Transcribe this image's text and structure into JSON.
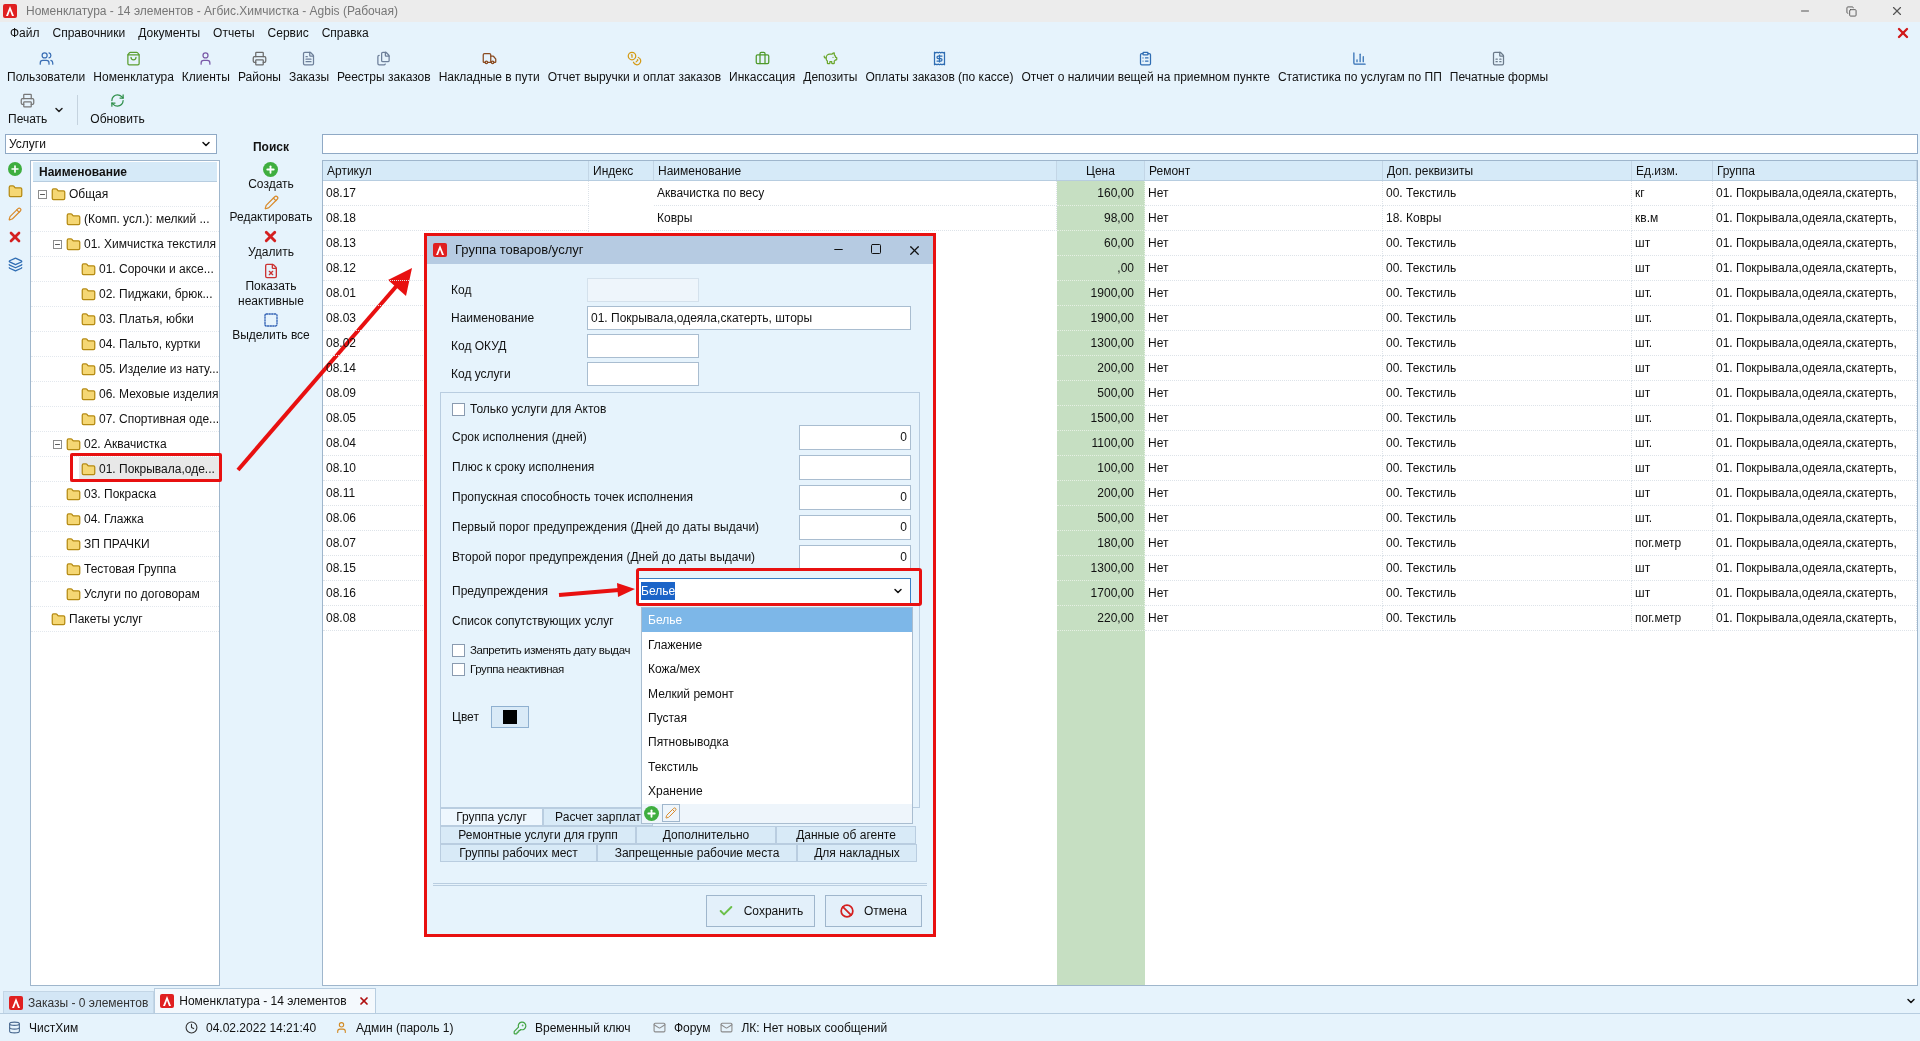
{
  "window": {
    "title": "Номенклатура - 14 элементов - Агбис.Химчистка - Agbis (Рабочая)"
  },
  "menu": [
    "Файл",
    "Справочники",
    "Документы",
    "Отчеты",
    "Сервис",
    "Справка"
  ],
  "toolbar": [
    "Пользователи",
    "Номенклатура",
    "Клиенты",
    "Районы",
    "Заказы",
    "Реестры заказов",
    "Накладные в пути",
    "Отчет выручки и оплат заказов",
    "Инкассация",
    "Депозиты",
    "Оплаты заказов (по кассе)",
    "Отчет о наличии вещей на приемном пункте",
    "Статистика по услугам по ПП",
    "Печатные формы"
  ],
  "toolbar2": [
    {
      "label": "Печать",
      "has_menu": true
    },
    {
      "label": "Обновить",
      "has_menu": false
    }
  ],
  "category_select": {
    "value": "Услуги"
  },
  "tree": {
    "column": "Наименование",
    "items": [
      {
        "label": "Общая",
        "expanded": true,
        "selected": false,
        "children": [
          {
            "label": "(Комп. усл.): мелкий ...",
            "selected": false
          },
          {
            "label": "01. Химчистка текстиля",
            "expanded": true,
            "selected": false,
            "children": [
              {
                "label": "01. Сорочки и аксе...",
                "selected": false
              },
              {
                "label": "02. Пиджаки, брюк...",
                "selected": false
              },
              {
                "label": "03. Платья, юбки",
                "selected": false
              },
              {
                "label": "04. Пальто, куртки",
                "selected": false
              },
              {
                "label": "05. Изделие из нату...",
                "selected": false
              },
              {
                "label": "06. Меховые изделия",
                "selected": false
              },
              {
                "label": "07. Спортивная оде...",
                "selected": false
              }
            ]
          },
          {
            "label": "02. Аквачистка",
            "expanded": true,
            "selected": false,
            "children": [
              {
                "label": "01. Покрывала,оде...",
                "selected": true
              }
            ]
          },
          {
            "label": "03. Покраска",
            "selected": false
          },
          {
            "label": "04. Глажка",
            "selected": false
          },
          {
            "label": "ЗП ПРАЧКИ",
            "selected": false
          },
          {
            "label": "Тестовая Группа",
            "selected": false
          },
          {
            "label": "Услуги по договорам",
            "selected": false
          }
        ]
      },
      {
        "label": "Пакеты услуг",
        "selected": false
      }
    ]
  },
  "search": {
    "title": "Поиск",
    "actions": [
      {
        "label": "Создать",
        "kind": "create"
      },
      {
        "label": "Редактировать",
        "kind": "edit"
      },
      {
        "label": "Удалить",
        "kind": "delete"
      },
      {
        "label": "Показать неактивные",
        "kind": "inactive"
      },
      {
        "label": "Выделить все",
        "kind": "select_all"
      }
    ]
  },
  "table": {
    "columns": [
      {
        "label": "Артикул",
        "highlighted": false
      },
      {
        "label": "Индекс",
        "highlighted": false
      },
      {
        "label": "Наименование",
        "highlighted": false
      },
      {
        "label": "Цена",
        "highlighted": true
      },
      {
        "label": "Ремонт",
        "highlighted": false
      },
      {
        "label": "Доп. реквизиты",
        "highlighted": false
      },
      {
        "label": "Ед.изм.",
        "highlighted": false
      },
      {
        "label": "Группа",
        "highlighted": false
      }
    ],
    "rows": [
      {
        "article": "08.17",
        "name": "Аквачистка по весу",
        "price": "160,00",
        "repair": "Нет",
        "extra": "00. Текстиль",
        "unit": "кг",
        "group": "01. Покрывала,одеяла,скатерть,"
      },
      {
        "article": "08.18",
        "name": "Ковры",
        "price": "98,00",
        "repair": "Нет",
        "extra": "18. Ковры",
        "unit": "кв.м",
        "group": "01. Покрывала,одеяла,скатерть,"
      },
      {
        "article": "08.13",
        "price": "60,00",
        "repair": "Нет",
        "extra": "00. Текстиль",
        "unit": "шт",
        "group": "01. Покрывала,одеяла,скатерть,"
      },
      {
        "article": "08.12",
        "price": ",00",
        "repair": "Нет",
        "extra": "00. Текстиль",
        "unit": "шт",
        "group": "01. Покрывала,одеяла,скатерть,"
      },
      {
        "article": "08.01",
        "price": "1900,00",
        "repair": "Нет",
        "extra": "00. Текстиль",
        "unit": "шт.",
        "group": "01. Покрывала,одеяла,скатерть,"
      },
      {
        "article": "08.03",
        "price": "1900,00",
        "repair": "Нет",
        "extra": "00. Текстиль",
        "unit": "шт.",
        "group": "01. Покрывала,одеяла,скатерть,"
      },
      {
        "article": "08.02",
        "price": "1300,00",
        "repair": "Нет",
        "extra": "00. Текстиль",
        "unit": "шт.",
        "group": "01. Покрывала,одеяла,скатерть,"
      },
      {
        "article": "08.14",
        "price": "200,00",
        "repair": "Нет",
        "extra": "00. Текстиль",
        "unit": "шт",
        "group": "01. Покрывала,одеяла,скатерть,"
      },
      {
        "article": "08.09",
        "price": "500,00",
        "repair": "Нет",
        "extra": "00. Текстиль",
        "unit": "шт",
        "group": "01. Покрывала,одеяла,скатерть,"
      },
      {
        "article": "08.05",
        "price": "1500,00",
        "repair": "Нет",
        "extra": "00. Текстиль",
        "unit": "шт.",
        "group": "01. Покрывала,одеяла,скатерть,"
      },
      {
        "article": "08.04",
        "price": "1100,00",
        "repair": "Нет",
        "extra": "00. Текстиль",
        "unit": "шт.",
        "group": "01. Покрывала,одеяла,скатерть,"
      },
      {
        "article": "08.10",
        "price": "100,00",
        "repair": "Нет",
        "extra": "00. Текстиль",
        "unit": "шт",
        "group": "01. Покрывала,одеяла,скатерть,"
      },
      {
        "article": "08.11",
        "price": "200,00",
        "repair": "Нет",
        "extra": "00. Текстиль",
        "unit": "шт",
        "group": "01. Покрывала,одеяла,скатерть,"
      },
      {
        "article": "08.06",
        "price": "500,00",
        "repair": "Нет",
        "extra": "00. Текстиль",
        "unit": "шт.",
        "group": "01. Покрывала,одеяла,скатерть,"
      },
      {
        "article": "08.07",
        "price": "180,00",
        "repair": "Нет",
        "extra": "00. Текстиль",
        "unit": "пог.метр",
        "group": "01. Покрывала,одеяла,скатерть,"
      },
      {
        "article": "08.15",
        "price": "1300,00",
        "repair": "Нет",
        "extra": "00. Текстиль",
        "unit": "шт",
        "group": "01. Покрывала,одеяла,скатерть,"
      },
      {
        "article": "08.16",
        "price": "1700,00",
        "repair": "Нет",
        "extra": "00. Текстиль",
        "unit": "шт",
        "group": "01. Покрывала,одеяла,скатерть,"
      },
      {
        "article": "08.08",
        "price": "220,00",
        "repair": "Нет",
        "extra": "00. Текстиль",
        "unit": "пог.метр",
        "group": "01. Покрывала,одеяла,скатерть,"
      }
    ]
  },
  "dialog": {
    "title": "Группа товаров/услуг",
    "fields": [
      {
        "label": "Код",
        "disabled": true
      },
      {
        "label": "Наименование",
        "value": "01. Покрывала,одеяла,скатерть, шторы",
        "disabled": false
      },
      {
        "label": "Код ОКУД",
        "disabled": false
      },
      {
        "label": "Код услуги",
        "disabled": false
      }
    ],
    "only_acts": {
      "label": "Только услуги для Актов",
      "checked": false
    },
    "settings": [
      {
        "label": "Срок исполнения (дней)",
        "value": "0"
      },
      {
        "label": "Плюс к сроку исполнения"
      },
      {
        "label": "Пропускная способность точек исполнения",
        "value": "0"
      },
      {
        "label": "Первый порог предупреждения (Дней до даты выдачи)",
        "value": "0"
      },
      {
        "label": "Второй порог предупреждения (Дней до даты выдачи)",
        "value": "0"
      }
    ],
    "warnings": {
      "label": "Предупреждения",
      "value": "Белье",
      "value_highlighted": true,
      "open": true,
      "options": [
        {
          "label": "Белье",
          "selected": true
        },
        {
          "label": "Глажение",
          "selected": false
        },
        {
          "label": "Кожа/мех",
          "selected": false
        },
        {
          "label": "Мелкий ремонт",
          "selected": false
        },
        {
          "label": "Пустая",
          "selected": false
        },
        {
          "label": "Пятновыводка",
          "selected": false
        },
        {
          "label": "Текстиль",
          "selected": false
        },
        {
          "label": "Хранение",
          "selected": false
        }
      ]
    },
    "related_label": "Список сопутствующих услуг",
    "checks": [
      {
        "label": "Запретить изменять дату выдач",
        "checked": false
      },
      {
        "label": "Группа неактивная",
        "checked": false
      }
    ],
    "color_field": {
      "label": "Цвет",
      "color": "#000000"
    },
    "tab_rows": [
      {
        "tabs": [
          {
            "label": "Группа услуг",
            "selected": true
          },
          {
            "label": "Расчет зарплат",
            "selected": false
          }
        ]
      },
      {
        "tabs": [
          {
            "label": "Ремонтные услуги для групп",
            "selected": false
          },
          {
            "label": "Дополнительно",
            "selected": false
          },
          {
            "label": "Данные об агенте",
            "selected": false
          }
        ]
      },
      {
        "tabs": [
          {
            "label": "Группы рабочих мест",
            "selected": false
          },
          {
            "label": "Запрещенные рабочие места",
            "selected": false
          },
          {
            "label": "Для накладных",
            "selected": false
          }
        ]
      }
    ],
    "buttons": [
      {
        "label": "Сохранить",
        "kind": "save"
      },
      {
        "label": "Отмена",
        "kind": "cancel"
      }
    ]
  },
  "doc_tabs": [
    {
      "label": "Заказы - 0 элементов",
      "selected": false,
      "closable": false
    },
    {
      "label": "Номенклатура - 14 элементов",
      "selected": true,
      "closable": true
    }
  ],
  "status_bar": [
    {
      "kind": "db",
      "text": "ЧистХим"
    },
    {
      "kind": "clock",
      "text": "04.02.2022 14:21:40"
    },
    {
      "kind": "user",
      "text": "Админ (пароль 1)"
    },
    {
      "kind": "key",
      "text": "Временный ключ"
    },
    {
      "kind": "mail",
      "text": "Форум"
    },
    {
      "kind": "mail",
      "text": "ЛК: Нет новых сообщений"
    }
  ]
}
